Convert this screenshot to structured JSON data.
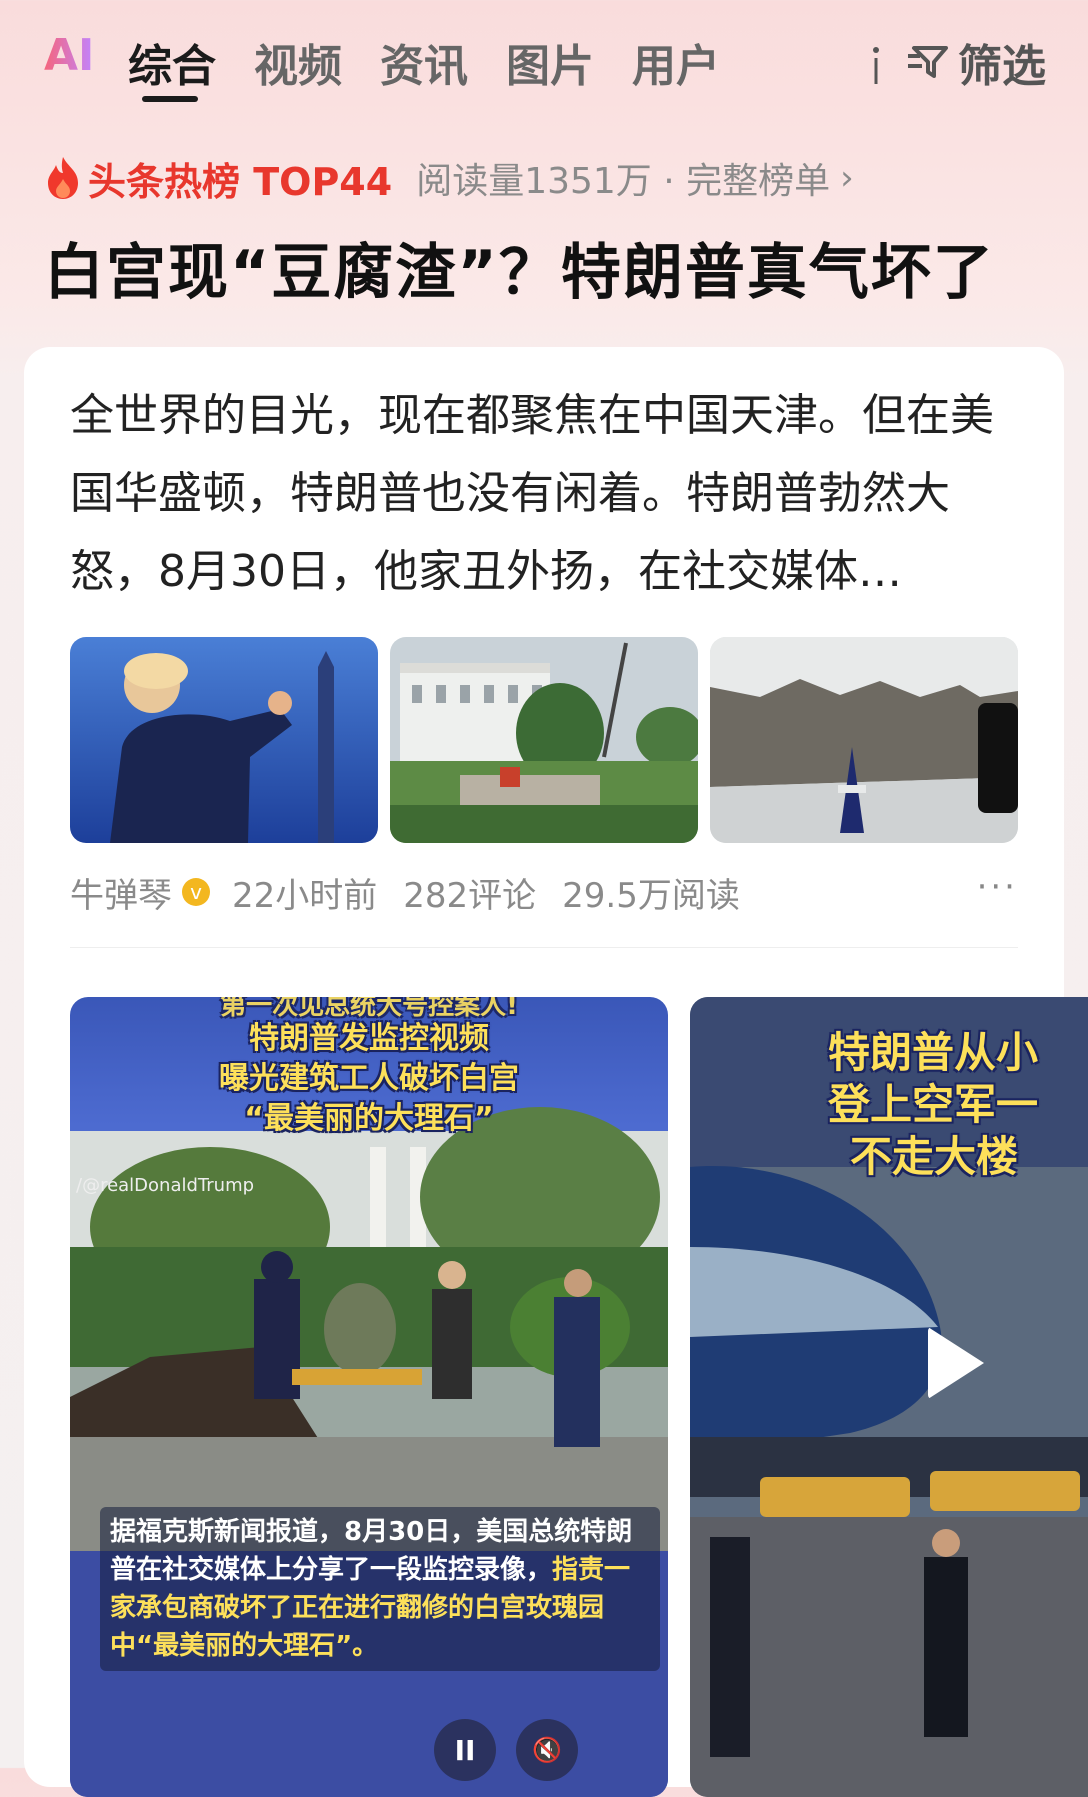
{
  "tabs": {
    "ai": "AI",
    "items": [
      "综合",
      "视频",
      "资讯",
      "图片",
      "用户"
    ],
    "filter": "筛选"
  },
  "hot": {
    "label": "头条热榜 TOP44",
    "meta": "阅读量1351万 · 完整榜单",
    "chevron": "›"
  },
  "headline": "白宫现“豆腐渣”？特朗普真气坏了",
  "article": {
    "summary": "全世界的目光，现在都聚焦在中国天津。但在美国华盛顿，特朗普也没有闲着。特朗普勃然大怒，8月30日，他家丑外扬，在社交媒体…",
    "author": "牛弹琴",
    "time": "22小时前",
    "comments": "282评论",
    "reads": "29.5万阅读",
    "more": "···",
    "verified_mark": "v"
  },
  "video1": {
    "top_strip": "第一次见总统大号控案人!",
    "title_lines": [
      "特朗普发监控视频",
      "曝光建筑工人破坏白宫",
      "“最美丽的大理石”"
    ],
    "watermark": "/@realDonaldTrump",
    "caption_plain": "据福克斯新闻报道，8月30日，美国总统特朗普在社交媒体上分享了一段监控录像，",
    "caption_highlight": "指责一家承包商破坏了正在进行翻修的白宫玫瑰园中“最美丽的大理石”。",
    "pause": "II",
    "mute": "🔇"
  },
  "video2": {
    "title_lines": [
      "特朗普从小",
      "登上空军一",
      "不走大楼"
    ]
  },
  "colors": {
    "accent_red": "#e8372d",
    "caption_yellow": "#fde05a",
    "verified_gold": "#f3b720"
  }
}
